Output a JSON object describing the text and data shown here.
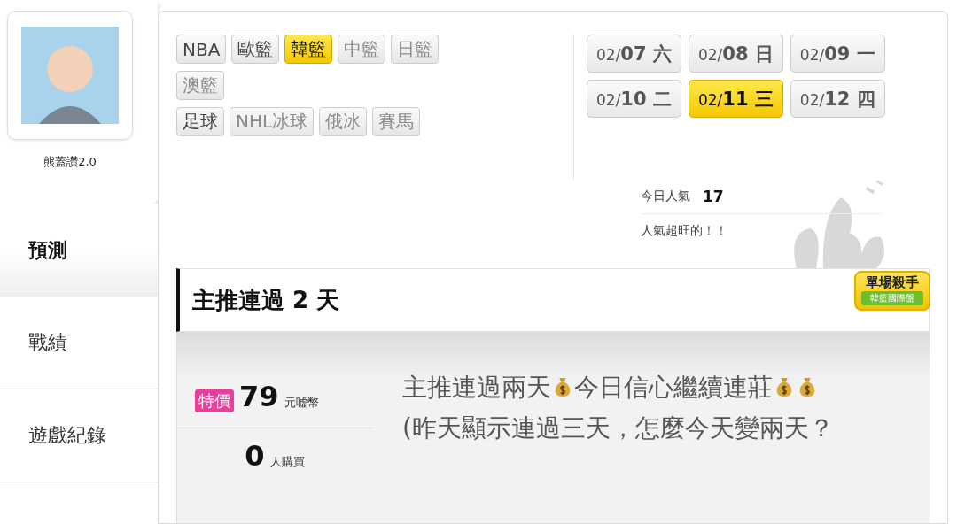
{
  "profile": {
    "name": "熊蓋讚2.0"
  },
  "sidebar": {
    "items": [
      {
        "label": "預測",
        "selected": true
      },
      {
        "label": "戰績",
        "selected": false
      },
      {
        "label": "遊戲紀錄",
        "selected": false
      }
    ]
  },
  "sports": {
    "rows": [
      [
        {
          "label": "NBA",
          "selected": false,
          "disabled": false
        },
        {
          "label": "歐籃",
          "selected": false,
          "disabled": false
        },
        {
          "label": "韓籃",
          "selected": true,
          "disabled": false
        },
        {
          "label": "中籃",
          "selected": false,
          "disabled": true
        },
        {
          "label": "日籃",
          "selected": false,
          "disabled": true
        }
      ],
      [
        {
          "label": "澳籃",
          "selected": false,
          "disabled": true
        }
      ],
      [
        {
          "label": "足球",
          "selected": false,
          "disabled": false
        },
        {
          "label": "NHL冰球",
          "selected": false,
          "disabled": true
        },
        {
          "label": "俄冰",
          "selected": false,
          "disabled": true
        },
        {
          "label": "賽馬",
          "selected": false,
          "disabled": true
        }
      ]
    ]
  },
  "dates": [
    {
      "month": "02/",
      "day": "07",
      "weekday": "六",
      "selected": false
    },
    {
      "month": "02/",
      "day": "08",
      "weekday": "日",
      "selected": false
    },
    {
      "month": "02/",
      "day": "09",
      "weekday": "一",
      "selected": false
    },
    {
      "month": "02/",
      "day": "10",
      "weekday": "二",
      "selected": false
    },
    {
      "month": "02/",
      "day": "11",
      "weekday": "三",
      "selected": true
    },
    {
      "month": "02/",
      "day": "12",
      "weekday": "四",
      "selected": false
    }
  ],
  "popularity": {
    "label": "今日人氣",
    "value": "17",
    "comment": "人氣超旺的！！"
  },
  "prediction": {
    "title": "主推連過 2 天",
    "badge": {
      "title": "單場殺手",
      "subtitle": "韓籃國際盤"
    },
    "price": {
      "tag": "特價",
      "amount": "79",
      "unit": "元嘘幣"
    },
    "buyers": {
      "count": "0",
      "unit": "人購買"
    },
    "message": [
      {
        "kind": "text",
        "text": "主推連過兩天"
      },
      {
        "kind": "icon"
      },
      {
        "kind": "text",
        "text": "今日信心繼續連莊"
      },
      {
        "kind": "icon"
      },
      {
        "kind": "icon"
      },
      {
        "kind": "text",
        "text": "　(昨天顯示連過三天，怎麼今天變兩天？"
      }
    ]
  }
}
